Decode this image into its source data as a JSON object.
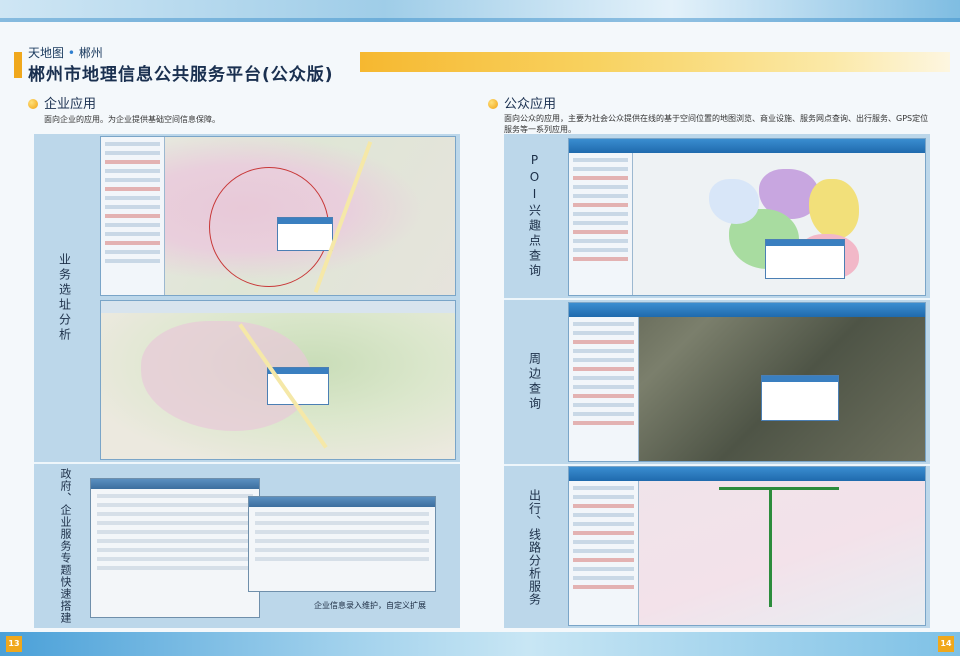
{
  "brand": {
    "sky": "天地图",
    "city": "郴州",
    "dot": "•"
  },
  "title": "郴州市地理信息公共服务平台(公众版)",
  "enterprise": {
    "title": "企业应用",
    "desc": "面向企业的应用。为企业提供基础空间信息保障。",
    "label_site": "业务选址分析",
    "label_gov": "政府、企业服务专题快速搭建",
    "caption": "企业信息录入维护，自定义扩展"
  },
  "public": {
    "title": "公众应用",
    "desc": "面向公众的应用，主要为社会公众提供在线的基于空间位置的地图浏览、商业设施、服务网点查询、出行服务、GPS定位服务等一系列应用。",
    "label_poi": "POI兴趣点查询",
    "label_nearby": "周边查询",
    "label_route": "出行、线路分析服务"
  },
  "pages": {
    "left": "13",
    "right": "14"
  },
  "colors": {
    "accent": "#f0a81c",
    "brand_blue": "#2f7fd0",
    "panel_bg": "#bcd7ea"
  }
}
